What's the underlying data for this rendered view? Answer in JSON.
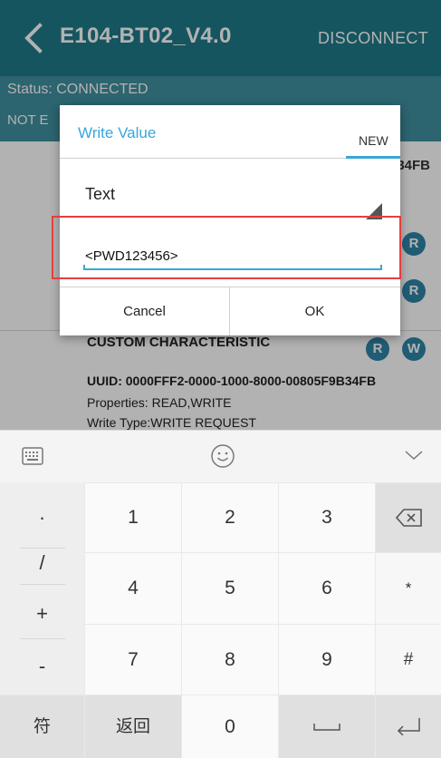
{
  "appbar": {
    "title": "E104-BT02_V4.0",
    "disconnect_label": "DISCONNECT",
    "back_icon": "chevron-left-icon"
  },
  "status": {
    "text": "Status: CONNECTED",
    "partial_text": "NOT E"
  },
  "background_content": {
    "uuid_snippet": "34FB",
    "badges": [
      "R",
      "R",
      "R",
      "R",
      "W"
    ],
    "characteristic": {
      "title": "CUSTOM CHARACTERISTIC",
      "uuid": "UUID: 0000FFF2-0000-1000-8000-00805F9B34FB",
      "properties": "Properties: READ,WRITE",
      "write_type": "Write Type:WRITE REQUEST"
    }
  },
  "dialog": {
    "title": "Write Value",
    "tab_label": "NEW",
    "spinner_value": "Text",
    "input_value": "<PWD123456>",
    "cancel_label": "Cancel",
    "ok_label": "OK"
  },
  "keyboard": {
    "toolbar_icons": [
      "keyboard-icon",
      "emoji-icon",
      "chevron-down-icon"
    ],
    "side_keys": [
      "·",
      "/",
      "+",
      "-"
    ],
    "rows": [
      [
        "1",
        "2",
        "3"
      ],
      [
        "4",
        "5",
        "6"
      ],
      [
        "7",
        "8",
        "9"
      ]
    ],
    "right_keys": [
      "*",
      "#"
    ],
    "bottom": {
      "symbol_label": "符",
      "back_label": "返回",
      "zero_label": "0"
    }
  },
  "colors": {
    "appbar": "#1f7a8a",
    "accent": "#3aa6d8",
    "highlight": "#e53e3e"
  }
}
